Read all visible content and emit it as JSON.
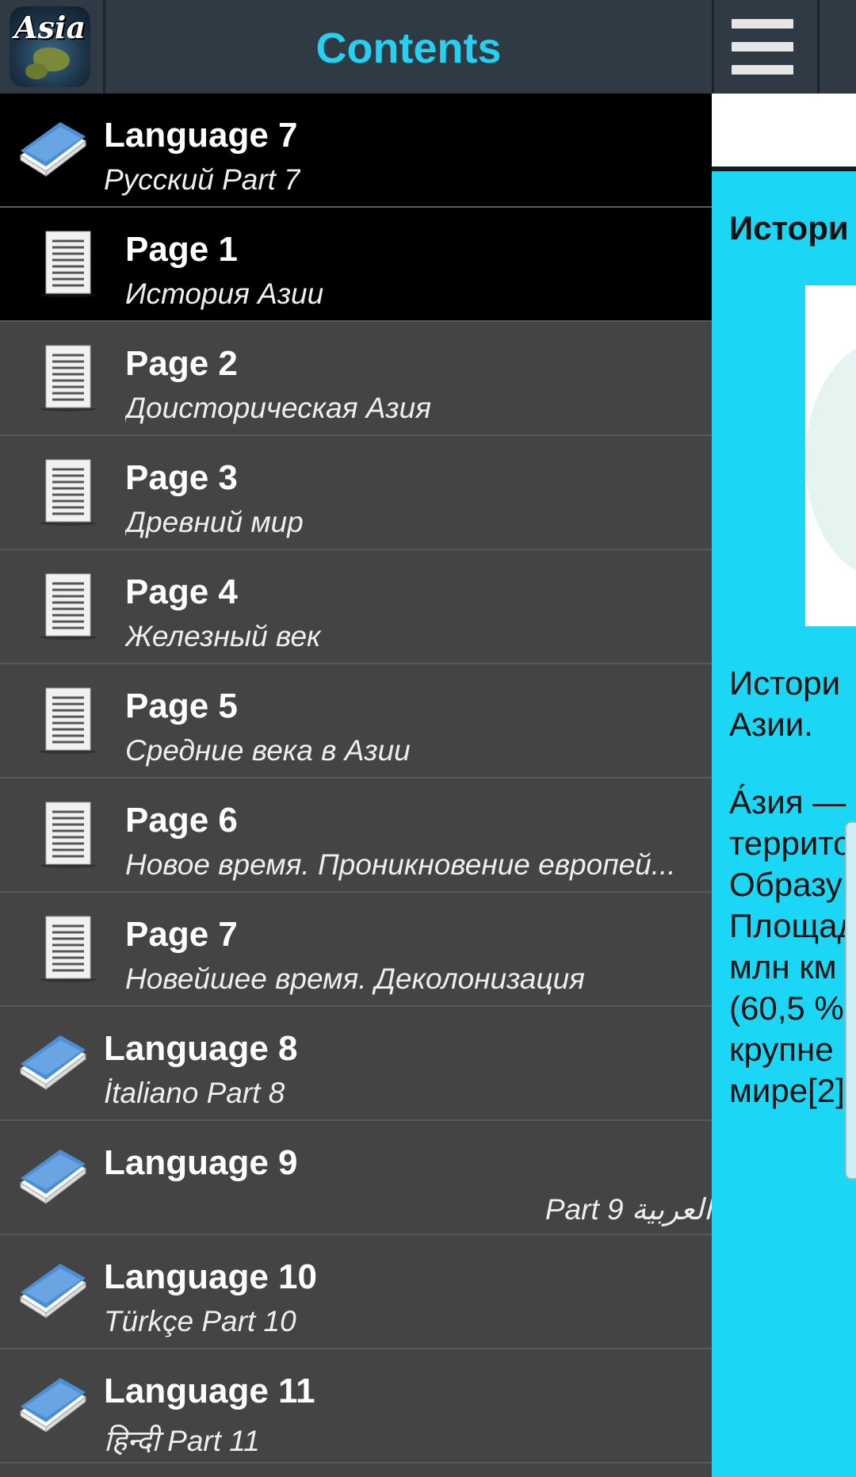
{
  "app": {
    "logo_text": "Asia",
    "title": "Contents",
    "colors": {
      "accent": "#25d0f0",
      "panel": "#1bd6f5",
      "topbar": "#2f3a44",
      "list_bg": "#444444",
      "active_bg": "#000000"
    }
  },
  "list": {
    "items": [
      {
        "type": "language",
        "title": "Language 7",
        "subtitle": "Русский Part 7",
        "icon": "book-icon",
        "active": true
      },
      {
        "type": "page",
        "title": "Page 1",
        "subtitle": "История Азии",
        "icon": "page-icon",
        "active": true
      },
      {
        "type": "page",
        "title": "Page 2",
        "subtitle": "Доисторическая Азия",
        "icon": "page-icon"
      },
      {
        "type": "page",
        "title": "Page 3",
        "subtitle": "Древний мир",
        "icon": "page-icon"
      },
      {
        "type": "page",
        "title": "Page 4",
        "subtitle": "Железный век",
        "icon": "page-icon"
      },
      {
        "type": "page",
        "title": "Page 5",
        "subtitle": "Средние века в Азии",
        "icon": "page-icon"
      },
      {
        "type": "page",
        "title": "Page 6",
        "subtitle": "Новое время. Проникновение европей...",
        "icon": "page-icon"
      },
      {
        "type": "page",
        "title": "Page 7",
        "subtitle": "Новейшее время. Деколонизация",
        "icon": "page-icon"
      },
      {
        "type": "language",
        "title": "Language 8",
        "subtitle": "İtaliano Part 8",
        "icon": "book-icon"
      },
      {
        "type": "language",
        "title": "Language 9",
        "subtitle": "العربية Part 9",
        "icon": "book-icon",
        "rtl": true
      },
      {
        "type": "language",
        "title": "Language 10",
        "subtitle": "Türkçe Part 10",
        "icon": "book-icon"
      },
      {
        "type": "language",
        "title": "Language 11",
        "subtitle": "हिन्दी Part 11",
        "icon": "book-icon"
      }
    ]
  },
  "panel": {
    "heading": "Истори",
    "para1_line1": "Истори",
    "para1_line2": "Азии.",
    "para2_lines": [
      "А́зия —",
      "террито",
      "Образу",
      "Площад",
      "млн км",
      "(60,5 %",
      "крупне",
      "мире[2]"
    ]
  }
}
